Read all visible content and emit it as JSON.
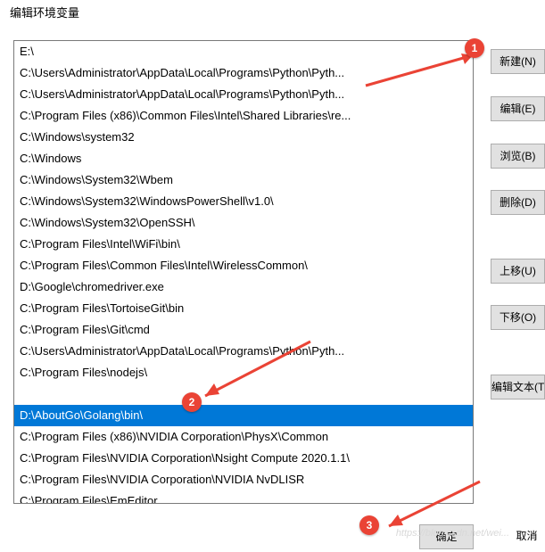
{
  "window_title": "编辑环境变量",
  "list_selected_index": 17,
  "list_items": [
    "E:\\",
    "C:\\Users\\Administrator\\AppData\\Local\\Programs\\Python\\Pyth...",
    "C:\\Users\\Administrator\\AppData\\Local\\Programs\\Python\\Pyth...",
    "C:\\Program Files (x86)\\Common Files\\Intel\\Shared Libraries\\re...",
    "C:\\Windows\\system32",
    "C:\\Windows",
    "C:\\Windows\\System32\\Wbem",
    "C:\\Windows\\System32\\WindowsPowerShell\\v1.0\\",
    "C:\\Windows\\System32\\OpenSSH\\",
    "C:\\Program Files\\Intel\\WiFi\\bin\\",
    "C:\\Program Files\\Common Files\\Intel\\WirelessCommon\\",
    "D:\\Google\\chromedriver.exe",
    "C:\\Program Files\\TortoiseGit\\bin",
    "C:\\Program Files\\Git\\cmd",
    "C:\\Users\\Administrator\\AppData\\Local\\Programs\\Python\\Pyth...",
    "C:\\Program Files\\nodejs\\",
    "",
    "D:\\AboutGo\\Golang\\bin\\",
    "C:\\Program Files (x86)\\NVIDIA Corporation\\PhysX\\Common",
    "C:\\Program Files\\NVIDIA Corporation\\Nsight Compute 2020.1.1\\",
    "C:\\Program Files\\NVIDIA Corporation\\NVIDIA NvDLISR",
    "C:\\Program Files\\EmEditor"
  ],
  "buttons": {
    "new_btn": "新建(N)",
    "edit_btn": "编辑(E)",
    "browse_btn": "浏览(B)",
    "delete_btn": "删除(D)",
    "up_btn": "上移(U)",
    "down_btn": "下移(O)",
    "text_btn": "编辑文本(T)",
    "ok_btn": "确定",
    "cancel_btn": "取消"
  },
  "badges": {
    "b1": "1",
    "b2": "2",
    "b3": "3"
  },
  "watermark": "https://blog.csdn.net/wei..."
}
